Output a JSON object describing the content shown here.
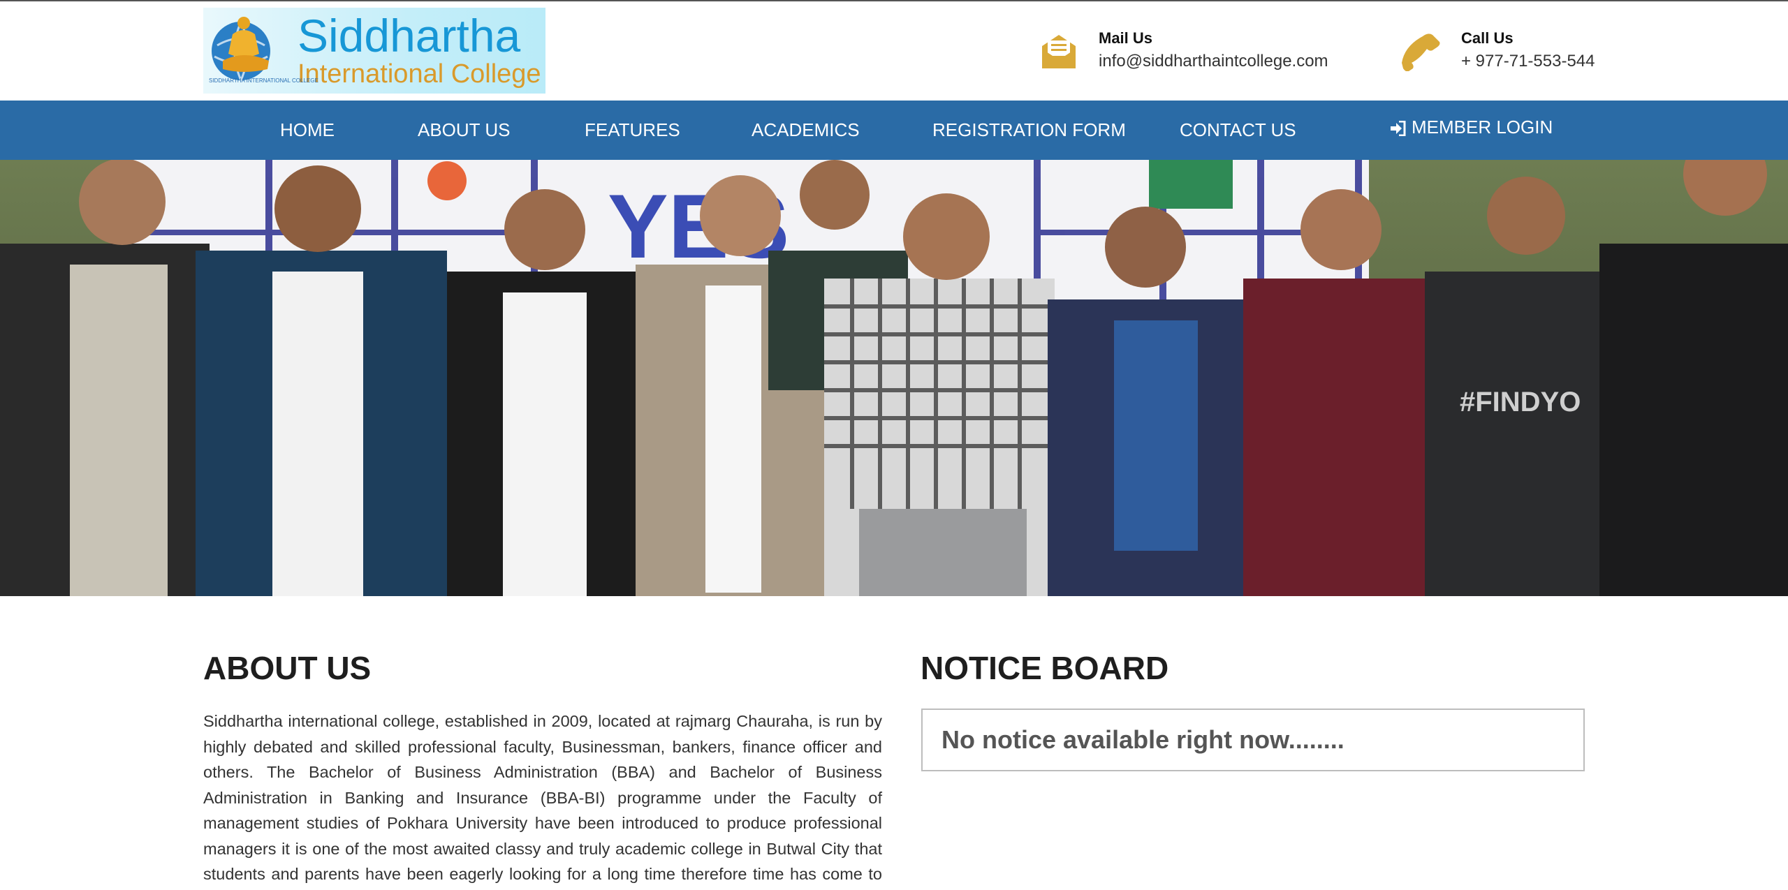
{
  "brand": {
    "name_line1": "Siddhartha",
    "name_line2": "International College",
    "logo_small_text": "SIDDHARTHA INTERNATIONAL COLLEGE"
  },
  "contacts": {
    "mail": {
      "title": "Mail Us",
      "value": "info@siddharthaintcollege.com",
      "icon": "envelope-icon"
    },
    "call": {
      "title": "Call Us",
      "value": "+ 977-71-553-544",
      "icon": "phone-icon"
    }
  },
  "nav": {
    "items": [
      {
        "label": "HOME"
      },
      {
        "label": "ABOUT US"
      },
      {
        "label": "FEATURES"
      },
      {
        "label": "ACADEMICS"
      },
      {
        "label": "REGISTRATION FORM"
      },
      {
        "label": "CONTACT US"
      }
    ],
    "login_label": "MEMBER LOGIN",
    "login_icon": "sign-in-icon"
  },
  "hero": {
    "alt": "Group photo of college staff and students in front of an event banner"
  },
  "about": {
    "title": "ABOUT US",
    "text": "Siddhartha international college, established in 2009, located at rajmarg Chauraha, is run by highly debated and skilled professional faculty, Businessman, bankers, finance officer and others. The Bachelor of Business Administration (BBA) and Bachelor of Business Administration in Banking and Insurance (BBA-BI) programme under the Faculty of management studies of Pokhara University have been introduced to produce professional managers it is one of the most awaited classy and truly academic college in Butwal City that students and parents have been eagerly looking for a long time therefore time has come to check out the state-of-the-art infrastructure no faculty professionals and"
  },
  "notice": {
    "title": "NOTICE BOARD",
    "empty_text": "No notice available right now........"
  },
  "colors": {
    "nav_bg": "#2a6ba6",
    "icon_gold": "#d9a938",
    "logo_blue": "#1797d6",
    "logo_gold": "#d99a2b"
  }
}
